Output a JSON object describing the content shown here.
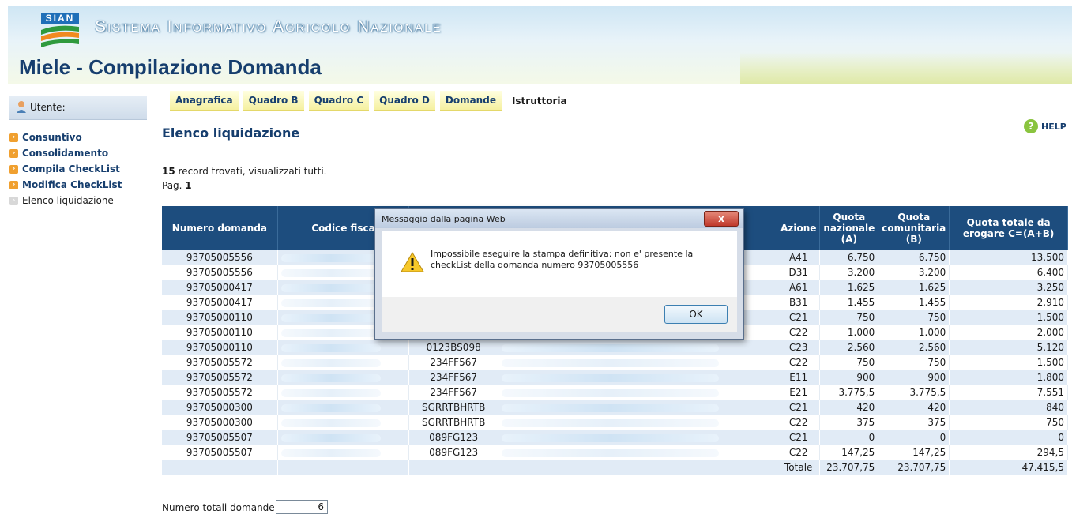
{
  "header": {
    "logo_text": "SIAN",
    "site_title": "Sistema Informativo Agricolo Nazionale",
    "app_title": "Miele - Compilazione Domanda"
  },
  "user": {
    "label": "Utente:"
  },
  "sidebar": {
    "items": [
      {
        "label": "Consuntivo"
      },
      {
        "label": "Consolidamento"
      },
      {
        "label": "Compila CheckList"
      },
      {
        "label": "Modifica CheckList"
      },
      {
        "label": "Elenco liquidazione"
      }
    ]
  },
  "tabs": [
    {
      "label": "Anagrafica"
    },
    {
      "label": "Quadro B"
    },
    {
      "label": "Quadro C"
    },
    {
      "label": "Quadro D"
    },
    {
      "label": "Domande"
    },
    {
      "label": "Istruttoria"
    }
  ],
  "main": {
    "title": "Elenco liquidazione",
    "help": "HELP",
    "records_count": "15",
    "records_text": " record trovati, visualizzati tutti.",
    "page_label": "Pag. ",
    "page_number": "1"
  },
  "table": {
    "headers": {
      "numero": "Numero domanda",
      "codice": "Codice fisca",
      "azione": "Azione",
      "quota_naz_1": "Quota",
      "quota_naz_2": "nazionale",
      "quota_naz_3": "(A)",
      "quota_com_1": "Quota",
      "quota_com_2": "comunitaria",
      "quota_com_3": "(B)",
      "quota_tot_1": "Quota totale da",
      "quota_tot_2": "erogare C=(A+B)"
    },
    "rows": [
      {
        "numero": "93705005556",
        "codice2": "",
        "azione": "A41",
        "naz": "6.750",
        "com": "6.750",
        "tot": "13.500"
      },
      {
        "numero": "93705005556",
        "codice2": "",
        "azione": "D31",
        "naz": "3.200",
        "com": "3.200",
        "tot": "6.400"
      },
      {
        "numero": "93705000417",
        "codice2": "",
        "azione": "A61",
        "naz": "1.625",
        "com": "1.625",
        "tot": "3.250"
      },
      {
        "numero": "93705000417",
        "codice2": "",
        "azione": "B31",
        "naz": "1.455",
        "com": "1.455",
        "tot": "2.910"
      },
      {
        "numero": "93705000110",
        "codice2": "",
        "azione": "C21",
        "naz": "750",
        "com": "750",
        "tot": "1.500"
      },
      {
        "numero": "93705000110",
        "codice2": "",
        "azione": "C22",
        "naz": "1.000",
        "com": "1.000",
        "tot": "2.000"
      },
      {
        "numero": "93705000110",
        "codice2": "0123BS098",
        "azione": "C23",
        "naz": "2.560",
        "com": "2.560",
        "tot": "5.120"
      },
      {
        "numero": "93705005572",
        "codice2": "234FF567",
        "azione": "C22",
        "naz": "750",
        "com": "750",
        "tot": "1.500"
      },
      {
        "numero": "93705005572",
        "codice2": "234FF567",
        "azione": "E11",
        "naz": "900",
        "com": "900",
        "tot": "1.800"
      },
      {
        "numero": "93705005572",
        "codice2": "234FF567",
        "azione": "E21",
        "naz": "3.775,5",
        "com": "3.775,5",
        "tot": "7.551"
      },
      {
        "numero": "93705000300",
        "codice2": "SGRRTBHRTB",
        "azione": "C21",
        "naz": "420",
        "com": "420",
        "tot": "840"
      },
      {
        "numero": "93705000300",
        "codice2": "SGRRTBHRTB",
        "azione": "C22",
        "naz": "375",
        "com": "375",
        "tot": "750"
      },
      {
        "numero": "93705005507",
        "codice2": "089FG123",
        "azione": "C21",
        "naz": "0",
        "com": "0",
        "tot": "0"
      },
      {
        "numero": "93705005507",
        "codice2": "089FG123",
        "azione": "C22",
        "naz": "147,25",
        "com": "147,25",
        "tot": "294,5"
      }
    ],
    "total": {
      "label": "Totale",
      "naz": "23.707,75",
      "com": "23.707,75",
      "tot": "47.415,5"
    }
  },
  "footer": {
    "label": "Numero totali domande",
    "value": "6"
  },
  "dialog": {
    "title": "Messaggio dalla pagina Web",
    "close": "x",
    "message": "Impossibile eseguire la stampa definitiva: non e' presente la checkList della domanda numero 93705005556",
    "ok": "OK"
  }
}
